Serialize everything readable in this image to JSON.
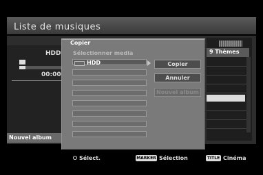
{
  "header": {
    "title": "Liste de musiques"
  },
  "left_panel": {
    "source": "HDD",
    "time": "00:00",
    "progress_fraction": 0.15
  },
  "right_panel": {
    "themes_label": "9 Thèmes"
  },
  "bottom_left": {
    "button_label": "Nouvel album"
  },
  "dialog": {
    "title": "Copier",
    "subtitle": "Sélectionner media",
    "media_items": [
      "HDD",
      "",
      "",
      "",
      "",
      "",
      "",
      ""
    ],
    "buttons": {
      "copy": "Copier",
      "cancel": "Annuler",
      "new_album": "Nouvel album"
    }
  },
  "footer": {
    "select_label": "Sélect.",
    "marker_badge": "MARKER",
    "marker_label": "Sélection",
    "title_badge": "TITLE",
    "title_label": "Cinéma"
  },
  "icons": [
    "enter-icon",
    "disc-icon",
    "hdd-icon",
    "arrow-right-icon"
  ]
}
